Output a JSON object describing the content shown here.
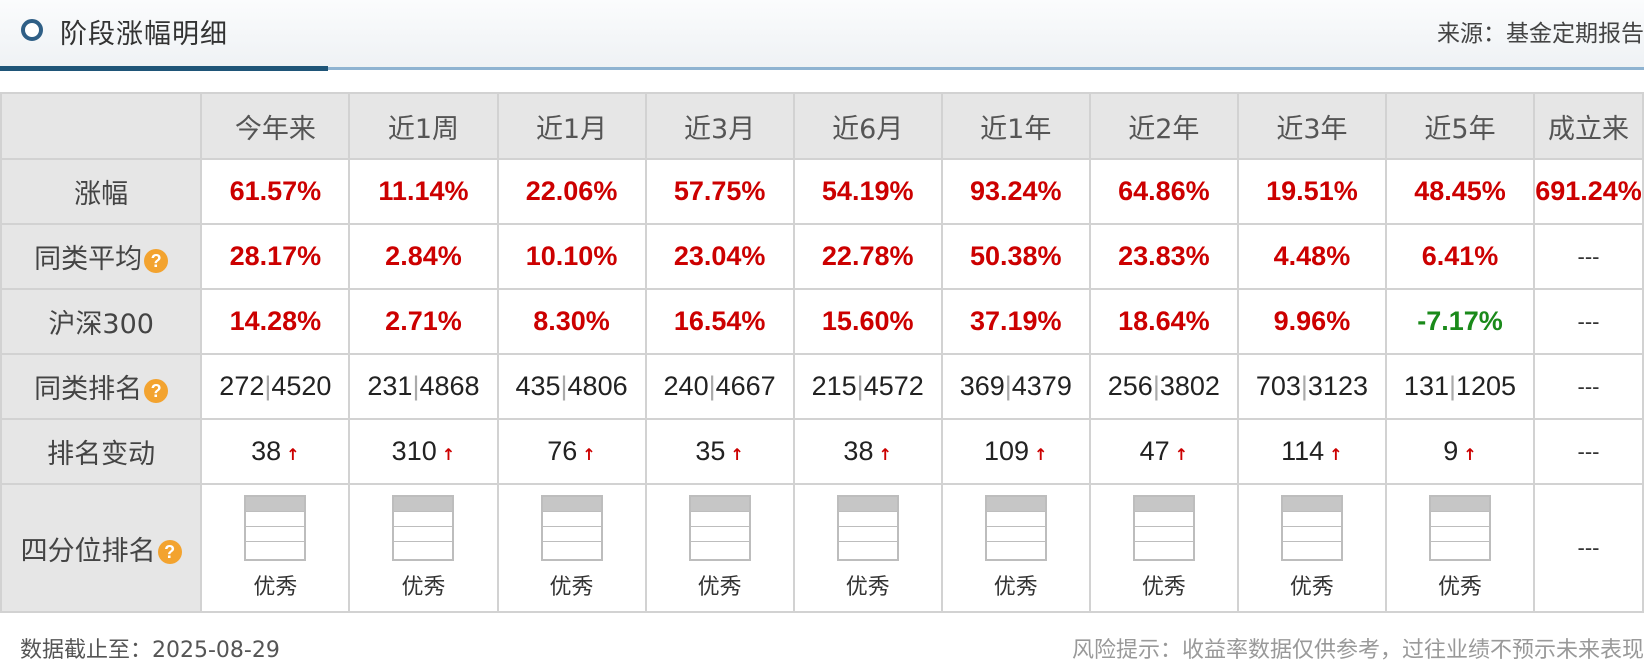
{
  "header": {
    "title": "阶段涨幅明细",
    "source": "来源：基金定期报告"
  },
  "table": {
    "columns": [
      "今年来",
      "近1周",
      "近1月",
      "近3月",
      "近6月",
      "近1年",
      "近2年",
      "近3年",
      "近5年",
      "成立来"
    ],
    "rows": {
      "gain": {
        "label": "涨幅",
        "values": [
          "61.57%",
          "11.14%",
          "22.06%",
          "57.75%",
          "54.19%",
          "93.24%",
          "64.86%",
          "19.51%",
          "48.45%",
          "691.24%"
        ]
      },
      "peer_avg": {
        "label": "同类平均",
        "values": [
          "28.17%",
          "2.84%",
          "10.10%",
          "23.04%",
          "22.78%",
          "50.38%",
          "23.83%",
          "4.48%",
          "6.41%",
          "---"
        ]
      },
      "hs300": {
        "label": "沪深300",
        "values": [
          "14.28%",
          "2.71%",
          "8.30%",
          "16.54%",
          "15.60%",
          "37.19%",
          "18.64%",
          "9.96%",
          "-7.17%",
          "---"
        ]
      },
      "rank": {
        "label": "同类排名",
        "values": [
          {
            "rank": "272",
            "total": "4520"
          },
          {
            "rank": "231",
            "total": "4868"
          },
          {
            "rank": "435",
            "total": "4806"
          },
          {
            "rank": "240",
            "total": "4667"
          },
          {
            "rank": "215",
            "total": "4572"
          },
          {
            "rank": "369",
            "total": "4379"
          },
          {
            "rank": "256",
            "total": "3802"
          },
          {
            "rank": "703",
            "total": "3123"
          },
          {
            "rank": "131",
            "total": "1205"
          }
        ],
        "last": "---"
      },
      "rank_change": {
        "label": "排名变动",
        "values": [
          "38",
          "310",
          "76",
          "35",
          "38",
          "109",
          "47",
          "114",
          "9"
        ],
        "arrow": "↑",
        "last": "---"
      },
      "quartile": {
        "label": "四分位排名",
        "values": [
          "优秀",
          "优秀",
          "优秀",
          "优秀",
          "优秀",
          "优秀",
          "优秀",
          "优秀",
          "优秀"
        ],
        "last": "---"
      }
    },
    "help_icon": "?"
  },
  "footer": {
    "date": "数据截止至：2025-08-29",
    "risk": "风险提示：收益率数据仅供参考，过往业绩不预示未来表现"
  },
  "colors": {
    "positive": "#cc0000",
    "negative": "#1a8a1a",
    "header_bg": "#e6e6e6",
    "accent": "#1f5578"
  },
  "icons": [
    "circle-bullet-icon",
    "question-help-icon",
    "up-arrow-icon",
    "quartile-bar-icon"
  ]
}
